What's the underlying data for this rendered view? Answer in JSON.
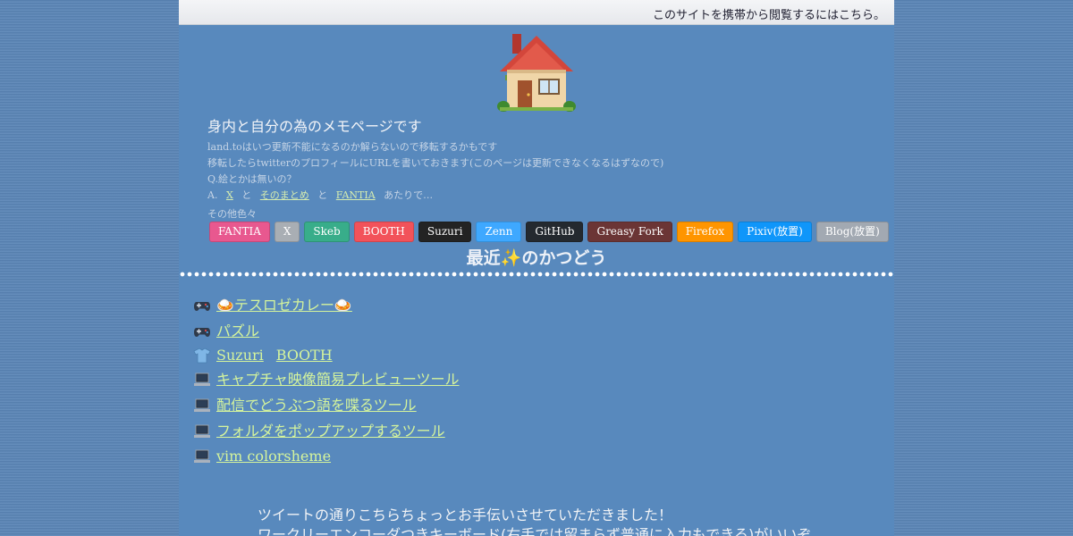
{
  "topbar": {
    "mobile_link": "このサイトを携帯から閲覧するにはこちら。"
  },
  "header": {
    "icon": "house-emoji"
  },
  "intro": {
    "title": "身内と自分の為のメモページです",
    "line1": "land.toはいつ更新不能になるのか解らないので移転するかもです",
    "line2": "移転したらtwitterのプロフィールにURLを書いておきます(このページは更新できなくなるはずなので)",
    "line3": "Q.絵とかは無いの？",
    "answer_prefix": "A.",
    "answer_link_x": "X",
    "answer_and1": "と",
    "answer_link_matome": "そのまとめ",
    "answer_and2": "と",
    "answer_link_fantia": "FANTIA",
    "answer_suffix": "あたりで…",
    "misc": "その他色々"
  },
  "badges": [
    {
      "label": "FANTIA",
      "color": "#e8588f"
    },
    {
      "label": "X",
      "color": "#a9aeb4"
    },
    {
      "label": "Skeb",
      "color": "#38ad8a"
    },
    {
      "label": "BOOTH",
      "color": "#f2525a"
    },
    {
      "label": "Suzuri",
      "color": "#232323"
    },
    {
      "label": "Zenn",
      "color": "#3ea8ff"
    },
    {
      "label": "GitHub",
      "color": "#24292f"
    },
    {
      "label": "Greasy Fork",
      "color": "#6b3535"
    },
    {
      "label": "Firefox",
      "color": "#ff9500"
    },
    {
      "label": "Pixiv(放置)",
      "color": "#0f96fa"
    },
    {
      "label": "Blog(放置)",
      "color": "#a2a9b2"
    }
  ],
  "recent": {
    "heading_prefix": "最近",
    "heading_icon": "✨",
    "heading_suffix": "のかつどう",
    "items": [
      {
        "icon": "gamepad-icon",
        "links": [
          "🍛テスロゼカレー🍛"
        ]
      },
      {
        "icon": "gamepad-icon",
        "links": [
          "パズル"
        ]
      },
      {
        "icon": "tshirt-icon",
        "links": [
          "Suzuri",
          "BOOTH"
        ]
      },
      {
        "icon": "laptop-icon",
        "links": [
          "キャプチャ映像簡易プレビューツール"
        ]
      },
      {
        "icon": "laptop-icon",
        "links": [
          "配信でどうぶつ語を喋るツール"
        ]
      },
      {
        "icon": "laptop-icon",
        "links": [
          "フォルダをポップアップするツール"
        ]
      },
      {
        "icon": "laptop-icon",
        "links": [
          "vim colorsheme"
        ]
      }
    ]
  },
  "bottom": {
    "line1": "ツイートの通りこちらちょっとお手伝いさせていただきました！",
    "line2": "ワークリーエンコーダつきキーボード(右手では留まらず普通に入力もできる)がいいぞ"
  }
}
